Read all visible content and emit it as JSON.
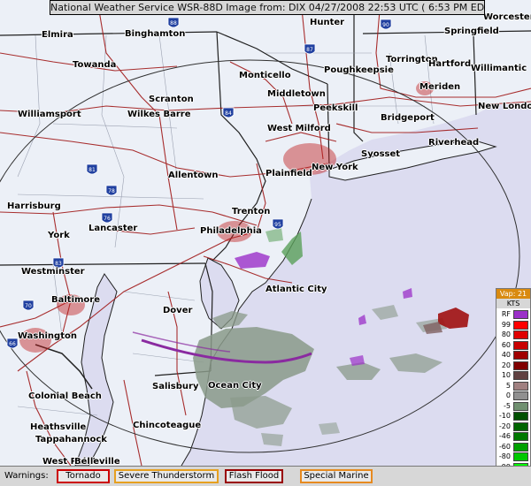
{
  "title": "National Weather Service WSR-88D Image from: DIX 04/27/2008 22:53 UTC ( 6:53 PM EDT)",
  "cities": [
    {
      "name": "Elmira",
      "key": "elmira"
    },
    {
      "name": "Binghamton",
      "key": "binghamton"
    },
    {
      "name": "Hunter",
      "key": "hunter"
    },
    {
      "name": "Worcester",
      "key": "worcester"
    },
    {
      "name": "Springfield",
      "key": "springfield"
    },
    {
      "name": "Towanda",
      "key": "towanda"
    },
    {
      "name": "Monticello",
      "key": "monticello"
    },
    {
      "name": "Poughkeepsie",
      "key": "poughkeepsie"
    },
    {
      "name": "Torrington",
      "key": "torrington"
    },
    {
      "name": "Hartford",
      "key": "hartford"
    },
    {
      "name": "Willimantic",
      "key": "willimantic"
    },
    {
      "name": "Middletown",
      "key": "middletown"
    },
    {
      "name": "Meriden",
      "key": "meriden"
    },
    {
      "name": "Scranton",
      "key": "scranton"
    },
    {
      "name": "Wilkes Barre",
      "key": "wilkes-barre"
    },
    {
      "name": "Peekskill",
      "key": "peekskill"
    },
    {
      "name": "New London",
      "key": "new-london"
    },
    {
      "name": "Williamsport",
      "key": "williamsport"
    },
    {
      "name": "Bridgeport",
      "key": "bridgeport"
    },
    {
      "name": "West Milford",
      "key": "west-milford"
    },
    {
      "name": "Riverhead",
      "key": "riverhead"
    },
    {
      "name": "Syosset",
      "key": "syosset"
    },
    {
      "name": "New York",
      "key": "new-york"
    },
    {
      "name": "Plainfield",
      "key": "plainfield"
    },
    {
      "name": "Allentown",
      "key": "allentown"
    },
    {
      "name": "Harrisburg",
      "key": "harrisburg"
    },
    {
      "name": "Trenton",
      "key": "trenton"
    },
    {
      "name": "Lancaster",
      "key": "lancaster"
    },
    {
      "name": "Philadelphia",
      "key": "philadelphia"
    },
    {
      "name": "York",
      "key": "york"
    },
    {
      "name": "Westminster",
      "key": "westminster"
    },
    {
      "name": "Atlantic City",
      "key": "atlantic-city"
    },
    {
      "name": "Baltimore",
      "key": "baltimore"
    },
    {
      "name": "Dover",
      "key": "dover"
    },
    {
      "name": "Washington",
      "key": "washington"
    },
    {
      "name": "Salisbury",
      "key": "salisbury"
    },
    {
      "name": "Ocean City",
      "key": "ocean-city"
    },
    {
      "name": "Colonial Beach",
      "key": "colonial-beach"
    },
    {
      "name": "Chincoteague",
      "key": "chincoteague"
    },
    {
      "name": "Heathsville",
      "key": "heathsville"
    },
    {
      "name": "Tappahannock",
      "key": "tappahannock"
    },
    {
      "name": "West Point",
      "key": "west-point"
    },
    {
      "name": "Belleville",
      "key": "belleville"
    }
  ],
  "interstate_shields": [
    "88",
    "90",
    "87",
    "84",
    "81",
    "78",
    "76",
    "95",
    "83",
    "70",
    "66"
  ],
  "legend": {
    "header": "Vap: 21",
    "unit": "KTS",
    "entries": [
      {
        "label": "RF",
        "color": "#9b30c8"
      },
      {
        "label": "99",
        "color": "#ff0000"
      },
      {
        "label": "80",
        "color": "#e00000"
      },
      {
        "label": "60",
        "color": "#c80000"
      },
      {
        "label": "40",
        "color": "#a00000"
      },
      {
        "label": "20",
        "color": "#800000"
      },
      {
        "label": "10",
        "color": "#604040"
      },
      {
        "label": "5",
        "color": "#a08080"
      },
      {
        "label": "0",
        "color": "#909090"
      },
      {
        "label": "-5",
        "color": "#709070"
      },
      {
        "label": "-10",
        "color": "#005000"
      },
      {
        "label": "-20",
        "color": "#006400"
      },
      {
        "label": "-46",
        "color": "#007800"
      },
      {
        "label": "-60",
        "color": "#00a000"
      },
      {
        "label": "-80",
        "color": "#00c800"
      },
      {
        "label": "-99",
        "color": "#00ff00"
      },
      {
        "label": "ND",
        "color": "#808080"
      }
    ]
  },
  "warnings": {
    "label": "Warnings:",
    "items": [
      {
        "label": "Tornado",
        "color": "#cc0000"
      },
      {
        "label": "Severe Thunderstorm",
        "color": "#e6a020"
      },
      {
        "label": "Flash Flood",
        "color": "#990000"
      },
      {
        "label": "Special Marine",
        "color": "#e68a20"
      }
    ]
  },
  "colors": {
    "land": "#ecf0f7",
    "ocean": "#dcdcf0",
    "border_line": "#202020",
    "county_line": "#9aa0b0",
    "highway": "#a01818",
    "range_ring": "#303030",
    "velocity_band": "#8a2aa0"
  }
}
